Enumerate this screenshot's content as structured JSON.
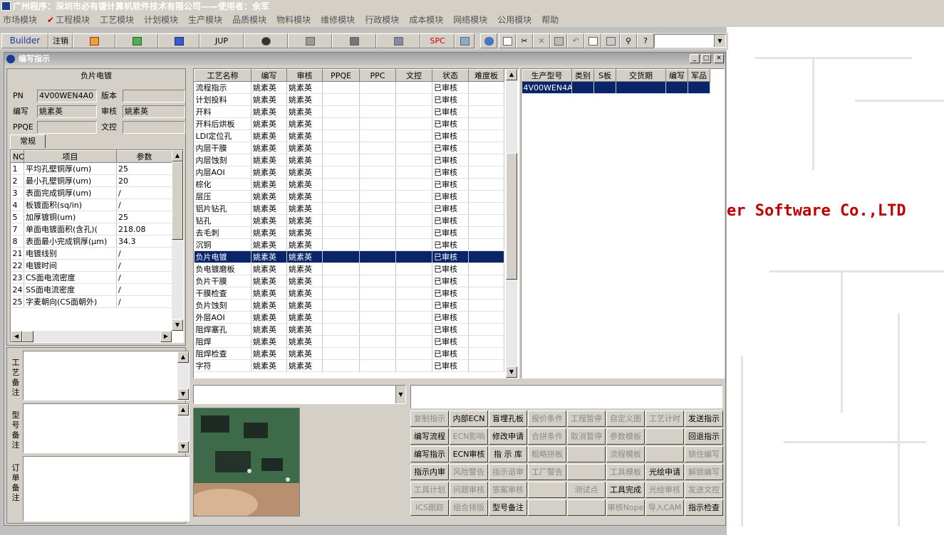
{
  "app_title": "广州程序：深圳市必有德计算机软件技术有限公司——使用者：余军",
  "menu": [
    "市场模块",
    "工程模块",
    "工艺模块",
    "计划模块",
    "生产模块",
    "品质模块",
    "物料模块",
    "维修模块",
    "行政模块",
    "成本模块",
    "网络模块",
    "公用模块",
    "帮助"
  ],
  "toolbar": {
    "builder": "Builder",
    "logout": "注销",
    "jup": "JUP",
    "spc": "SPC"
  },
  "desktop_text": "er Software Co.,LTD",
  "window": {
    "title": "编写指示",
    "min": "_",
    "max": "□",
    "close": "✕"
  },
  "left": {
    "section_title": "负片电镀",
    "pn_label": "PN",
    "pn_value": "4V00WEN4A0",
    "version_label": "版本",
    "version_value": "",
    "author_label": "编写",
    "author_value": "姚素英",
    "review_label": "审核",
    "review_value": "姚素英",
    "ppqe_label": "PPQE",
    "ppqe_value": "",
    "doc_label": "文控",
    "doc_value": "",
    "tab": "常规",
    "param_headers": [
      "NO",
      "项目",
      "参数"
    ],
    "params": [
      [
        "1",
        "平均孔壁铜厚(um)",
        "25"
      ],
      [
        "2",
        "最小孔壁铜厚(um)",
        "20"
      ],
      [
        "3",
        "表面完成铜厚(um)",
        "/"
      ],
      [
        "4",
        "板镀面积(sq/in)",
        "/"
      ],
      [
        "5",
        "加厚镀铜(um)",
        "25"
      ],
      [
        "7",
        "单面电镀面积(含孔)(",
        "218.08"
      ],
      [
        "8",
        "表面最小完成铜厚(μm)",
        "34.3"
      ],
      [
        "21",
        "电镀线别",
        "/"
      ],
      [
        "22",
        "电镀时间",
        "/"
      ],
      [
        "23",
        "CS面电流密度",
        "/"
      ],
      [
        "24",
        "SS面电流密度",
        "/"
      ],
      [
        "25",
        "字麦朝向(CS面朝外)",
        "/"
      ]
    ],
    "notes": [
      "工艺备注",
      "型号备注",
      "订单备注"
    ]
  },
  "process": {
    "headers": [
      "工艺名称",
      "编写",
      "审核",
      "PPQE",
      "PPC",
      "文控",
      "状态",
      "难度板"
    ],
    "selected_index": 14,
    "rows": [
      [
        "流程指示",
        "姚素英",
        "姚素英",
        "",
        "",
        "",
        "已审核",
        ""
      ],
      [
        "计划投料",
        "姚素英",
        "姚素英",
        "",
        "",
        "",
        "已审核",
        ""
      ],
      [
        "开料",
        "姚素英",
        "姚素英",
        "",
        "",
        "",
        "已审核",
        ""
      ],
      [
        "开料后烘板",
        "姚素英",
        "姚素英",
        "",
        "",
        "",
        "已审核",
        ""
      ],
      [
        "LDI定位孔",
        "姚素英",
        "姚素英",
        "",
        "",
        "",
        "已审核",
        ""
      ],
      [
        "内层干膜",
        "姚素英",
        "姚素英",
        "",
        "",
        "",
        "已审核",
        ""
      ],
      [
        "内层蚀刻",
        "姚素英",
        "姚素英",
        "",
        "",
        "",
        "已审核",
        ""
      ],
      [
        "内层AOI",
        "姚素英",
        "姚素英",
        "",
        "",
        "",
        "已审核",
        ""
      ],
      [
        "棕化",
        "姚素英",
        "姚素英",
        "",
        "",
        "",
        "已审核",
        ""
      ],
      [
        "层压",
        "姚素英",
        "姚素英",
        "",
        "",
        "",
        "已审核",
        ""
      ],
      [
        "铝片钻孔",
        "姚素英",
        "姚素英",
        "",
        "",
        "",
        "已审核",
        ""
      ],
      [
        "钻孔",
        "姚素英",
        "姚素英",
        "",
        "",
        "",
        "已审核",
        ""
      ],
      [
        "去毛刺",
        "姚素英",
        "姚素英",
        "",
        "",
        "",
        "已审核",
        ""
      ],
      [
        "沉铜",
        "姚素英",
        "姚素英",
        "",
        "",
        "",
        "已审核",
        ""
      ],
      [
        "负片电镀",
        "姚素英",
        "姚素英",
        "",
        "",
        "",
        "已审核",
        ""
      ],
      [
        "负电镀磨板",
        "姚素英",
        "姚素英",
        "",
        "",
        "",
        "已审核",
        ""
      ],
      [
        "负片干膜",
        "姚素英",
        "姚素英",
        "",
        "",
        "",
        "已审核",
        ""
      ],
      [
        "干膜检查",
        "姚素英",
        "姚素英",
        "",
        "",
        "",
        "已审核",
        ""
      ],
      [
        "负片蚀刻",
        "姚素英",
        "姚素英",
        "",
        "",
        "",
        "已审核",
        ""
      ],
      [
        "外层AOI",
        "姚素英",
        "姚素英",
        "",
        "",
        "",
        "已审核",
        ""
      ],
      [
        "阻焊塞孔",
        "姚素英",
        "姚素英",
        "",
        "",
        "",
        "已审核",
        ""
      ],
      [
        "阻焊",
        "姚素英",
        "姚素英",
        "",
        "",
        "",
        "已审核",
        ""
      ],
      [
        "阻焊检查",
        "姚素英",
        "姚素英",
        "",
        "",
        "",
        "已审核",
        ""
      ],
      [
        "字符",
        "姚素英",
        "姚素英",
        "",
        "",
        "",
        "已审核",
        ""
      ]
    ]
  },
  "production": {
    "headers": [
      "生产型号",
      "类别",
      "S板",
      "交货期",
      "编写",
      "军品"
    ],
    "rows": [
      [
        "4V00WEN4A0",
        "",
        "",
        "",
        "",
        ""
      ]
    ]
  },
  "actions": [
    [
      {
        "label": "复制指示",
        "enabled": false
      },
      {
        "label": "内部ECN",
        "enabled": true
      },
      {
        "label": "盲埋孔板",
        "enabled": true
      },
      {
        "label": "报价条件",
        "enabled": false
      },
      {
        "label": "工程暂停",
        "enabled": false
      },
      {
        "label": "自定义图",
        "enabled": false
      },
      {
        "label": "工艺计时",
        "enabled": false
      },
      {
        "label": "发送指示",
        "enabled": true
      }
    ],
    [
      {
        "label": "编写流程",
        "enabled": true
      },
      {
        "label": "ECN影响",
        "enabled": false
      },
      {
        "label": "修改申请",
        "enabled": true
      },
      {
        "label": "合拼条件",
        "enabled": false
      },
      {
        "label": "取消暂停",
        "enabled": false
      },
      {
        "label": "参数模板",
        "enabled": false
      },
      {
        "label": "",
        "enabled": false
      },
      {
        "label": "回退指示",
        "enabled": true
      }
    ],
    [
      {
        "label": "编写指示",
        "enabled": true
      },
      {
        "label": "ECN审核",
        "enabled": true
      },
      {
        "label": "指 示 库",
        "enabled": true
      },
      {
        "label": "粗略拼板",
        "enabled": false
      },
      {
        "label": "",
        "enabled": false
      },
      {
        "label": "流程模板",
        "enabled": false
      },
      {
        "label": "",
        "enabled": false
      },
      {
        "label": "锁住编写",
        "enabled": false
      }
    ],
    [
      {
        "label": "指示内审",
        "enabled": true
      },
      {
        "label": "风险警告",
        "enabled": false
      },
      {
        "label": "指示退审",
        "enabled": false
      },
      {
        "label": "工厂警告",
        "enabled": false
      },
      {
        "label": "",
        "enabled": false
      },
      {
        "label": "工具模板",
        "enabled": false
      },
      {
        "label": "光绘申请",
        "enabled": true
      },
      {
        "label": "解锁编写",
        "enabled": false
      }
    ],
    [
      {
        "label": "工具计划",
        "enabled": false
      },
      {
        "label": "问题审核",
        "enabled": false
      },
      {
        "label": "答案审核",
        "enabled": false
      },
      {
        "label": "",
        "enabled": false
      },
      {
        "label": "测试点",
        "enabled": false
      },
      {
        "label": "工具完成",
        "enabled": true
      },
      {
        "label": "光绘审核",
        "enabled": false
      },
      {
        "label": "发送文控",
        "enabled": false
      }
    ],
    [
      {
        "label": "ICS跟踪",
        "enabled": false
      },
      {
        "label": "组合排版",
        "enabled": false
      },
      {
        "label": "型号备注",
        "enabled": true
      },
      {
        "label": "",
        "enabled": false
      },
      {
        "label": "",
        "enabled": false
      },
      {
        "label": "审核Nope",
        "enabled": false
      },
      {
        "label": "导入CAM",
        "enabled": false
      },
      {
        "label": "指示检查",
        "enabled": true
      }
    ]
  ]
}
